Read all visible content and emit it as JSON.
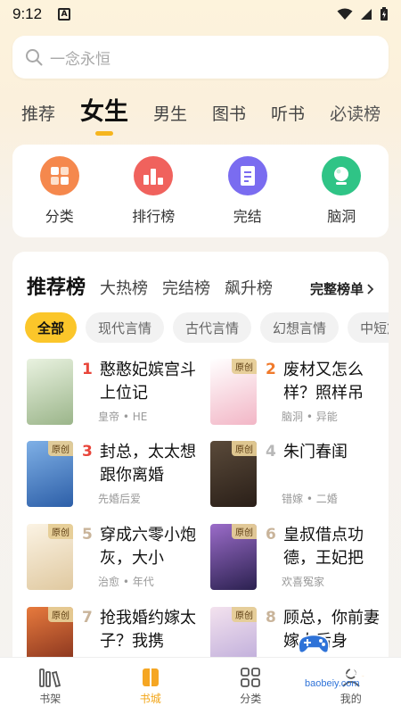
{
  "status_bar": {
    "time": "9:12",
    "notification": "A"
  },
  "search": {
    "placeholder": "一念永恒"
  },
  "top_tabs": [
    {
      "label": "推荐",
      "active": false
    },
    {
      "label": "女生",
      "active": true
    },
    {
      "label": "男生",
      "active": false
    },
    {
      "label": "图书",
      "active": false
    },
    {
      "label": "听书",
      "active": false
    },
    {
      "label": "必读榜",
      "active": false
    }
  ],
  "quick_entries": [
    {
      "label": "分类",
      "icon": "grid-icon",
      "color": "#f5884d"
    },
    {
      "label": "排行榜",
      "icon": "podium-icon",
      "color": "#f0625d"
    },
    {
      "label": "完结",
      "icon": "book-done-icon",
      "color": "#7a6cf0"
    },
    {
      "label": "脑洞",
      "icon": "crystal-ball-icon",
      "color": "#2fc486"
    }
  ],
  "rank": {
    "title": "推荐榜",
    "tabs": [
      "大热榜",
      "完结榜",
      "飙升榜"
    ],
    "more": "完整榜单",
    "chips": [
      "全部",
      "现代言情",
      "古代言情",
      "幻想言情",
      "中短篇"
    ],
    "books": [
      {
        "num": "1",
        "title": "憨憨妃嫔宫斗上位记",
        "meta": "皇帝 • HE",
        "tag": "",
        "num_color": "#e8453a",
        "cover": [
          "#e9f2e0",
          "#9bb58a"
        ]
      },
      {
        "num": "2",
        "title": "废材又怎么样？照样吊",
        "meta": "脑洞 • 异能",
        "tag": "原创",
        "num_color": "#f07a2c",
        "cover": [
          "#ffffff",
          "#f2b6c6"
        ]
      },
      {
        "num": "3",
        "title": "封总，太太想跟你离婚",
        "meta": "先婚后爱",
        "tag": "原创",
        "num_color": "#e8453a",
        "cover": [
          "#7fb0e6",
          "#2d5fa8"
        ]
      },
      {
        "num": "4",
        "title": "朱门春闺",
        "meta": "错嫁 • 二婚",
        "tag": "原创",
        "num_color": "#b8b8b8",
        "cover": [
          "#5a4a3a",
          "#2a1f18"
        ]
      },
      {
        "num": "5",
        "title": "穿成六零小炮灰，大小",
        "meta": "治愈 • 年代",
        "tag": "原创",
        "num_color": "#c9b49a",
        "cover": [
          "#fbf3e4",
          "#e0c9a0"
        ]
      },
      {
        "num": "6",
        "title": "皇叔借点功德，王妃把",
        "meta": "欢喜冤家",
        "tag": "原创",
        "num_color": "#c9b49a",
        "cover": [
          "#9b6cc9",
          "#2b2150"
        ]
      },
      {
        "num": "7",
        "title": "抢我婚约嫁太子？我携",
        "meta": "",
        "tag": "原创",
        "num_color": "#c9b49a",
        "cover": [
          "#e77a3d",
          "#7a2a1a"
        ]
      },
      {
        "num": "8",
        "title": "顾总，你前妻嫁人后身",
        "meta": "",
        "tag": "原创",
        "num_color": "#c9b49a",
        "cover": [
          "#f3e2ee",
          "#b8a6d8"
        ]
      }
    ]
  },
  "bottom_nav": [
    {
      "label": "书架",
      "active": false
    },
    {
      "label": "书城",
      "active": true
    },
    {
      "label": "分类",
      "active": false
    },
    {
      "label": "我的",
      "active": false
    }
  ],
  "watermark": {
    "text": "宝贝游戏网",
    "url": "baobeiy.com"
  }
}
